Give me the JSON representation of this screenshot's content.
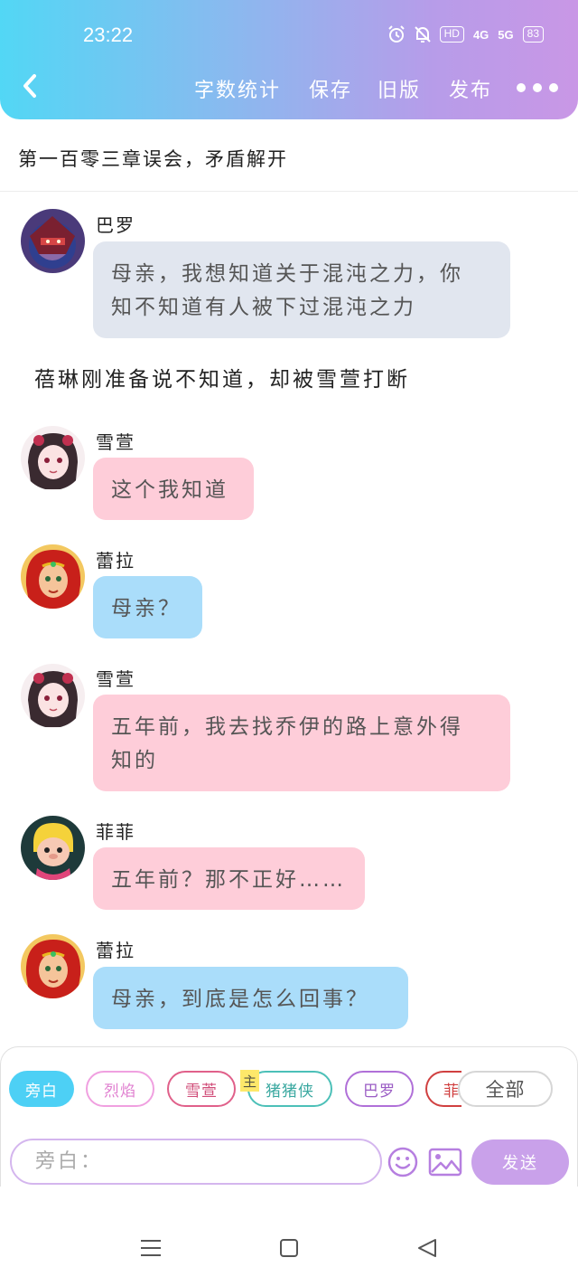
{
  "status_bar": {
    "time": "23:22",
    "network_badge": "HD",
    "sig1": "4G",
    "sig2": "5G",
    "battery": "83"
  },
  "toolbar": {
    "word_count": "字数统计",
    "save": "保存",
    "old_version": "旧版",
    "publish": "发布"
  },
  "chapter_title": "第一百零三章误会，矛盾解开",
  "messages": [
    {
      "speaker": "巴罗",
      "text1": "母亲，我想知道关于混沌之力，你",
      "text2": "知不知道有人被下过混沌之力"
    },
    {
      "narration": "蓓琳刚准备说不知道，却被雪萱打断"
    },
    {
      "speaker": "雪萱",
      "text1": "这个我知道"
    },
    {
      "speaker": "蕾拉",
      "text1": "母亲？"
    },
    {
      "speaker": "雪萱",
      "text1": "五年前，我去找乔伊的路上意外得",
      "text2": "知的"
    },
    {
      "speaker": "菲菲",
      "text1": "五年前？那不正好……"
    },
    {
      "speaker": "蕾拉",
      "text1": "母亲，到底是怎么回事？"
    }
  ],
  "roles": [
    "旁白",
    "烈焰",
    "雪萱",
    "猪猪侠",
    "巴罗",
    "菲"
  ],
  "main_badge": "主",
  "all_button": "全部",
  "input": {
    "value": "旁白："
  },
  "send_label": "发送",
  "colors": {
    "accent_cyan": "#4dd0f5",
    "accent_purple": "#c9a1ea"
  }
}
